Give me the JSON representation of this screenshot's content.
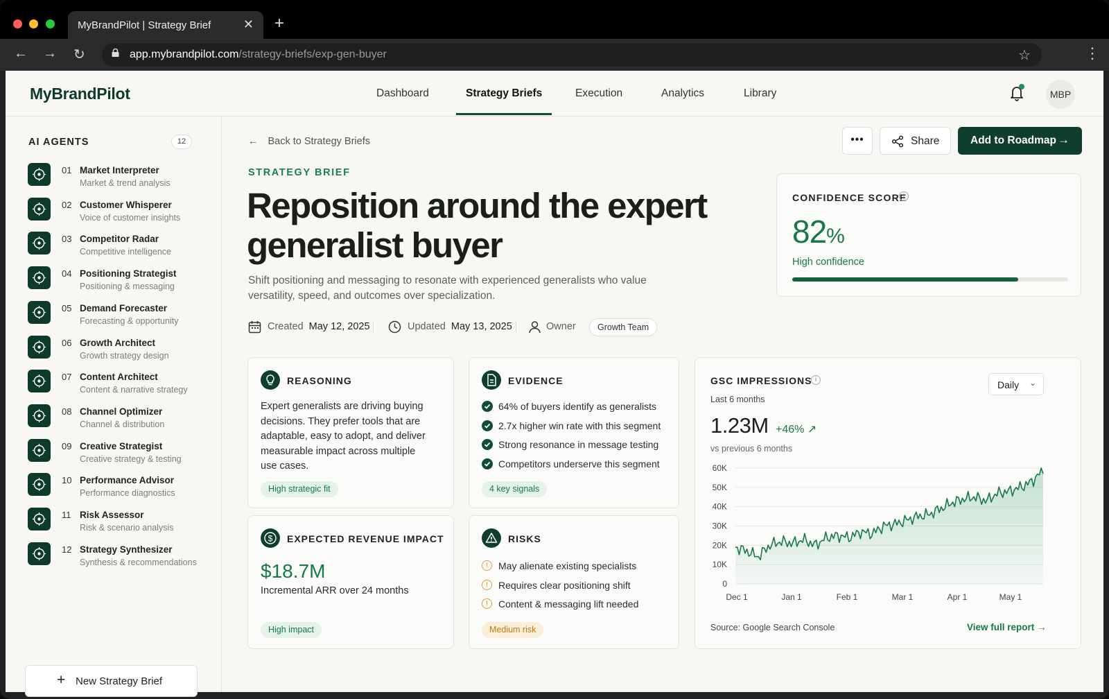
{
  "browser": {
    "tab_title": "MyBrandPilot | Strategy Brief",
    "url_domain": "app.mybrandpilot.com",
    "url_path": "/strategy-briefs/exp-gen-buyer"
  },
  "header": {
    "logo": "MyBrandPilot",
    "nav": [
      {
        "label": "Dashboard"
      },
      {
        "label": "Strategy Briefs",
        "active": true
      },
      {
        "label": "Execution"
      },
      {
        "label": "Analytics"
      },
      {
        "label": "Library"
      }
    ],
    "avatar": "MBP"
  },
  "sidebar": {
    "title": "AI AGENTS",
    "count": "12",
    "agents": [
      {
        "num": "01",
        "name": "Market Interpreter",
        "desc": "Market & trend analysis"
      },
      {
        "num": "02",
        "name": "Customer Whisperer",
        "desc": "Voice of customer insights"
      },
      {
        "num": "03",
        "name": "Competitor Radar",
        "desc": "Competitive intelligence"
      },
      {
        "num": "04",
        "name": "Positioning Strategist",
        "desc": "Positioning & messaging"
      },
      {
        "num": "05",
        "name": "Demand Forecaster",
        "desc": "Forecasting & opportunity"
      },
      {
        "num": "06",
        "name": "Growth Architect",
        "desc": "Growth strategy design"
      },
      {
        "num": "07",
        "name": "Content Architect",
        "desc": "Content & narrative strategy"
      },
      {
        "num": "08",
        "name": "Channel Optimizer",
        "desc": "Channel & distribution"
      },
      {
        "num": "09",
        "name": "Creative Strategist",
        "desc": "Creative strategy & testing"
      },
      {
        "num": "10",
        "name": "Performance Advisor",
        "desc": "Performance diagnostics"
      },
      {
        "num": "11",
        "name": "Risk Assessor",
        "desc": "Risk & scenario analysis"
      },
      {
        "num": "12",
        "name": "Strategy Synthesizer",
        "desc": "Synthesis & recommendations"
      }
    ],
    "new_button": "New Strategy Brief"
  },
  "main": {
    "back_link": "Back to Strategy Briefs",
    "share_label": "Share",
    "add_label": "Add to Roadmap",
    "eyebrow": "STRATEGY BRIEF",
    "title_line1": "Reposition around the expert",
    "title_line2": "generalist buyer",
    "subtitle": "Shift positioning and messaging to resonate with experienced generalists who value versatility, speed, and outcomes over specialization.",
    "meta": {
      "created_label": "Created",
      "created": "May 12, 2025",
      "updated_label": "Updated",
      "updated": "May 13, 2025",
      "owner_label": "Owner",
      "owner": "Growth Team"
    }
  },
  "confidence": {
    "label": "CONFIDENCE SCORE",
    "value": "82",
    "unit": "%",
    "fraction": 0.82,
    "text": "High confidence"
  },
  "reasoning": {
    "title": "REASONING",
    "body": "Expert generalists are driving buying decisions. They prefer tools that are adaptable, easy to adopt, and deliver measurable impact across multiple use cases.",
    "pill": "High strategic fit"
  },
  "evidence": {
    "title": "EVIDENCE",
    "items": [
      "64% of buyers identify as generalists",
      "2.7x higher win rate with this segment",
      "Strong resonance in message testing",
      "Competitors underserve this segment"
    ],
    "pill": "4 key signals"
  },
  "revenue": {
    "title": "EXPECTED REVENUE IMPACT",
    "value": "$18.7M",
    "sub": "Incremental ARR over 24 months",
    "pill": "High impact"
  },
  "risks": {
    "title": "RISKS",
    "items": [
      "May alienate existing specialists",
      "Requires clear positioning shift",
      "Content & messaging lift needed"
    ],
    "pill": "Medium risk"
  },
  "gsc": {
    "title": "GSC IMPRESSIONS",
    "period": "Last 6 months",
    "total": "1.23M",
    "delta": "+46%",
    "vs": "vs previous 6 months",
    "dropdown": "Daily",
    "source": "Source: Google Search Console",
    "link": "View full report"
  },
  "colors": {
    "brand_dark": "#0f3d2e",
    "accent_green": "#17784f",
    "risk_orange": "#e0a030"
  },
  "chart_data": {
    "type": "area",
    "ylim": [
      0,
      60000
    ],
    "y_ticks": [
      "0",
      "10K",
      "20K",
      "30K",
      "40K",
      "50K",
      "60K"
    ],
    "x_ticks": [
      "Dec 1",
      "Jan 1",
      "Feb 1",
      "Mar 1",
      "Apr 1",
      "May 1"
    ],
    "series": [
      {
        "x": [
          "Nov 27",
          "Dec 3",
          "Dec 9",
          "Dec 15",
          "Dec 21",
          "Dec 27",
          "Jan 2",
          "Jan 8",
          "Jan 14",
          "Jan 20",
          "Jan 26",
          "Feb 1",
          "Feb 7",
          "Feb 13",
          "Feb 19",
          "Feb 25",
          "Mar 3",
          "Mar 9",
          "Mar 15",
          "Mar 21",
          "Mar 27",
          "Apr 2",
          "Apr 8",
          "Apr 14",
          "Apr 20",
          "Apr 26",
          "May 2",
          "May 6"
        ],
        "y": [
          19000,
          17000,
          14000,
          20000,
          22000,
          21000,
          23000,
          20000,
          24000,
          25000,
          24000,
          27000,
          26000,
          30000,
          31000,
          33000,
          35000,
          36000,
          39000,
          42000,
          44000,
          45000,
          43000,
          47000,
          48000,
          50000,
          53000,
          59000
        ]
      }
    ]
  }
}
